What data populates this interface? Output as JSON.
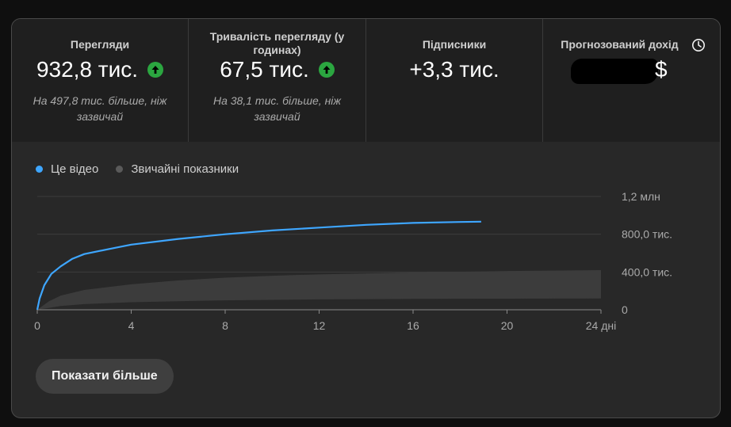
{
  "metrics": [
    {
      "label": "Перегляди",
      "value": "932,8 тис.",
      "trend": "up",
      "note": "На 497,8 тис. більше, ніж зазвичай"
    },
    {
      "label": "Тривалість перегляду (у годинах)",
      "value": "67,5 тис.",
      "trend": "up",
      "note": "На 38,1 тис. більше, ніж зазвичай"
    },
    {
      "label": "Підписники",
      "value": "+3,3 тис."
    },
    {
      "label": "Прогнозований дохід",
      "value_suffix": "$",
      "icon": "clock-icon"
    }
  ],
  "colors": {
    "this_video": "#3ea6ff",
    "typical": "#5a5a5a",
    "trend_up": "#2ba640"
  },
  "legend": [
    {
      "label": "Це відео",
      "color": "#3ea6ff"
    },
    {
      "label": "Звичайні показники",
      "color": "#5a5a5a"
    }
  ],
  "chart_data": {
    "type": "line",
    "x_ticks": [
      0,
      4,
      8,
      12,
      16,
      20,
      24
    ],
    "x_tick_labels": [
      "0",
      "4",
      "8",
      "12",
      "16",
      "20",
      "24 дні"
    ],
    "y_ticks": [
      0,
      400000,
      800000,
      1200000
    ],
    "y_tick_labels": [
      "0",
      "400,0 тис.",
      "800,0 тис.",
      "1,2 млн"
    ],
    "xlim": [
      0,
      24
    ],
    "ylim": [
      0,
      1200000
    ],
    "series": [
      {
        "name": "Це відео",
        "x": [
          0,
          0.1,
          0.3,
          0.6,
          1,
          1.5,
          2,
          3,
          4,
          6,
          8,
          10,
          12,
          14,
          16,
          18,
          18.9
        ],
        "y": [
          0,
          120000,
          260000,
          380000,
          460000,
          540000,
          590000,
          640000,
          690000,
          750000,
          800000,
          840000,
          870000,
          900000,
          920000,
          930000,
          932800
        ]
      }
    ],
    "typical_range": {
      "x": [
        0,
        0.5,
        1,
        2,
        4,
        6,
        8,
        10,
        12,
        16,
        20,
        24
      ],
      "low": [
        0,
        20000,
        40000,
        60000,
        80000,
        90000,
        100000,
        105000,
        110000,
        115000,
        118000,
        120000
      ],
      "high": [
        0,
        90000,
        150000,
        210000,
        270000,
        310000,
        340000,
        360000,
        375000,
        395000,
        410000,
        420000
      ]
    }
  },
  "button": {
    "label": "Показати більше"
  }
}
